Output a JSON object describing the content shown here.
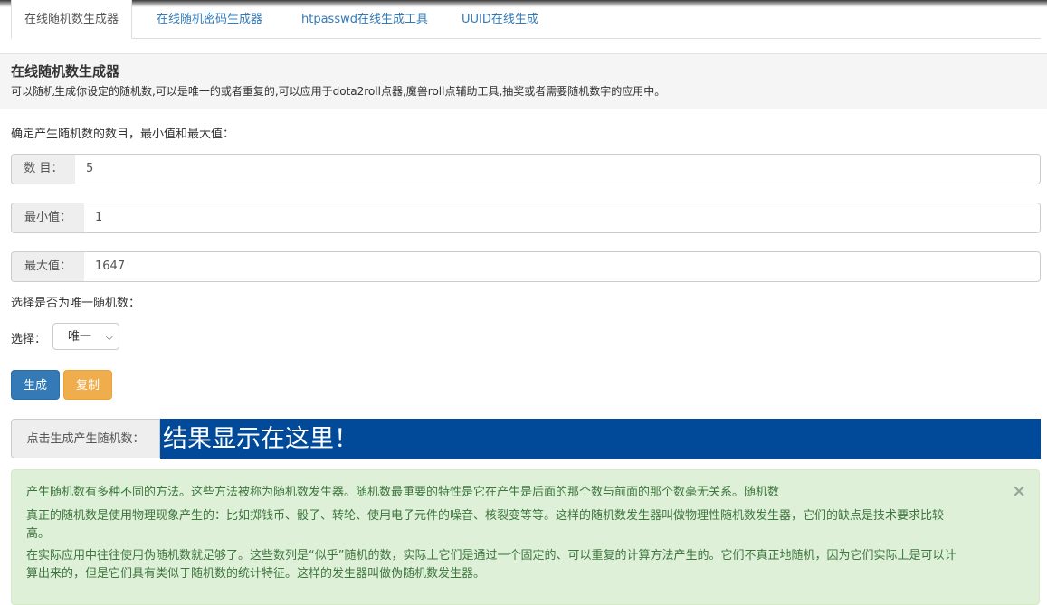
{
  "tabs": [
    {
      "label": "在线随机数生成器",
      "active": true
    },
    {
      "label": "在线随机密码生成器",
      "active": false
    },
    {
      "label": "htpasswd在线生成工具",
      "active": false
    },
    {
      "label": "UUID在线生成",
      "active": false
    }
  ],
  "panel": {
    "title": "在线随机数生成器",
    "description": "可以随机生成你设定的随机数,可以是唯一的或者重复的,可以应用于dota2roll点器,魔兽roll点辅助工具,抽奖或者需要随机数字的应用中。"
  },
  "form": {
    "intro": "确定产生随机数的数目，最小值和最大值：",
    "count": {
      "label": "数 目：",
      "value": "5"
    },
    "min": {
      "label": "最小值：",
      "value": "1"
    },
    "max": {
      "label": "最大值：",
      "value": "1647"
    },
    "unique_prompt": "选择是否为唯一随机数：",
    "select_label": "选择：",
    "select_value": "唯一",
    "generate_button": "生成",
    "copy_button": "复制"
  },
  "result": {
    "label": "点击生成产生随机数：",
    "text": "结果显示在这里！",
    "background": "#004a99"
  },
  "info": {
    "close": "×",
    "paragraphs": [
      "产生随机数有多种不同的方法。这些方法被称为随机数发生器。随机数最重要的特性是它在产生是后面的那个数与前面的那个数毫无关系。随机数",
      "真正的随机数是使用物理现象产生的：比如掷钱币、骰子、转轮、使用电子元件的噪音、核裂变等等。这样的随机数发生器叫做物理性随机数发生器，它们的缺点是技术要求比较",
      "高。",
      "在实际应用中往往使用伪随机数就足够了。这些数列是“似乎”随机的数，实际上它们是通过一个固定的、可以重复的计算方法产生的。它们不真正地随机，因为它们实际上是可以计",
      "算出来的，但是它们具有类似于随机数的统计特征。这样的发生器叫做伪随机数发生器。"
    ]
  },
  "colors": {
    "primary": "#337ab7",
    "warning": "#f0ad4e",
    "success_bg": "#dff0d8",
    "success_text": "#3c763d"
  }
}
